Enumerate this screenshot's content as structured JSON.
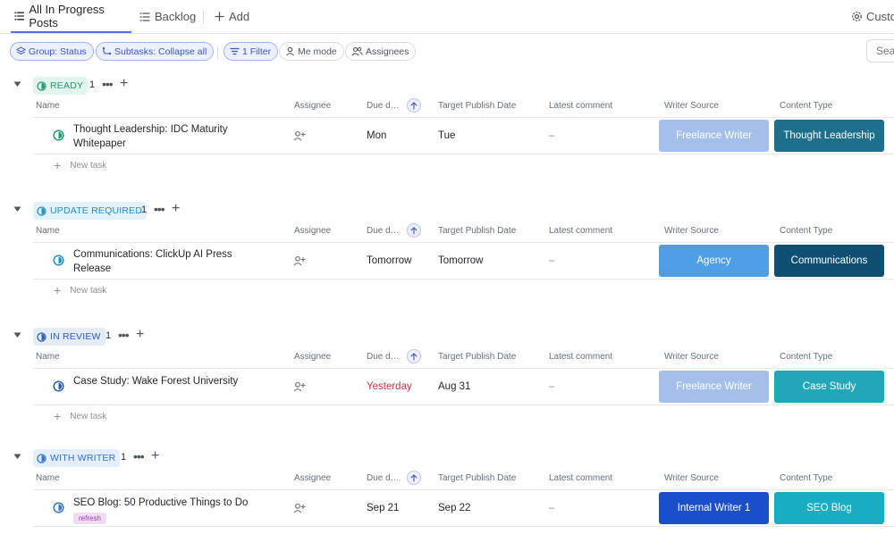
{
  "tabs": {
    "all_in_progress": "All In Progress Posts",
    "backlog": "Backlog",
    "add": "Add",
    "customize": "Customize"
  },
  "filters": {
    "group": "Group: Status",
    "subtasks": "Subtasks: Collapse all",
    "filter": "1 Filter",
    "me_mode": "Me mode",
    "assignees": "Assignees",
    "search_placeholder": "Search"
  },
  "columns": {
    "name": "Name",
    "assignee": "Assignee",
    "due": "Due d…",
    "target": "Target Publish Date",
    "comment": "Latest comment",
    "writer_source": "Writer Source",
    "content_type": "Content Type"
  },
  "new_task": "New task",
  "empty_comment": "–",
  "groups": [
    {
      "status": "READY",
      "count": "1",
      "color": "#1a9c6f",
      "bg": "#e3f6ee",
      "task": {
        "name": "Thought Leadership: IDC Maturity Whitepaper",
        "due": "Mon",
        "target": "Tue",
        "writer_source": "Freelance Writer",
        "writer_source_color": "#a3bfea",
        "content_type": "Thought Leadership",
        "content_type_color": "#1d6f8c"
      }
    },
    {
      "status": "UPDATE REQUIRED",
      "count": "1",
      "color": "#1f8fc7",
      "bg": "#e2f2fb",
      "task": {
        "name": "Communications: ClickUp AI Press Release",
        "due": "Tomorrow",
        "target": "Tomorrow",
        "writer_source": "Agency",
        "writer_source_color": "#4d9fe6",
        "content_type": "Communications",
        "content_type_color": "#0f4f71"
      }
    },
    {
      "status": "IN REVIEW",
      "count": "1",
      "color": "#2a5bb5",
      "bg": "#e4ecf8",
      "task": {
        "name": "Case Study: Wake Forest University",
        "due": "Yesterday",
        "due_overdue": true,
        "target": "Aug 31",
        "writer_source": "Freelance Writer",
        "writer_source_color": "#a3bfea",
        "content_type": "Case Study",
        "content_type_color": "#21a7b8"
      }
    },
    {
      "status": "WITH WRITER",
      "count": "1",
      "color": "#2f74d6",
      "bg": "#e4eefc",
      "task": {
        "name": "SEO Blog: 50 Productive Things to Do",
        "tag": "refresh",
        "due": "Sep 21",
        "target": "Sep 22",
        "writer_source": "Internal Writer 1",
        "writer_source_color": "#1b4fc9",
        "content_type": "SEO Blog",
        "content_type_color": "#17aec4"
      }
    }
  ]
}
